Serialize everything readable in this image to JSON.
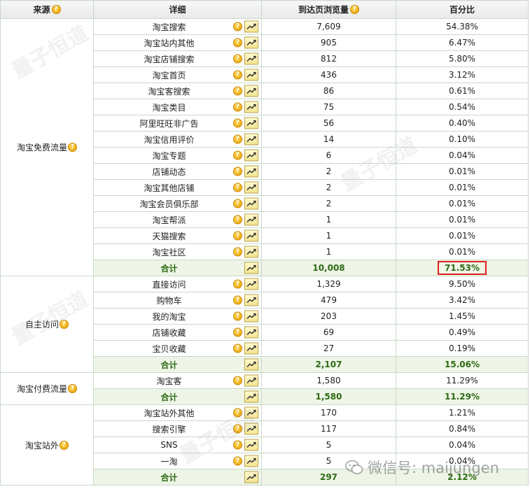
{
  "headers": {
    "source": "来源",
    "detail": "详细",
    "views": "到达页浏览量",
    "percent": "百分比"
  },
  "groups": [
    {
      "source": "淘宝免费流量",
      "rows": [
        {
          "detail": "淘宝搜索",
          "views": "7,609",
          "percent": "54.38%"
        },
        {
          "detail": "淘宝站内其他",
          "views": "905",
          "percent": "6.47%"
        },
        {
          "detail": "淘宝店铺搜索",
          "views": "812",
          "percent": "5.80%"
        },
        {
          "detail": "淘宝首页",
          "views": "436",
          "percent": "3.12%"
        },
        {
          "detail": "淘宝客搜索",
          "views": "86",
          "percent": "0.61%"
        },
        {
          "detail": "淘宝类目",
          "views": "75",
          "percent": "0.54%"
        },
        {
          "detail": "阿里旺旺非广告",
          "views": "56",
          "percent": "0.40%"
        },
        {
          "detail": "淘宝信用评价",
          "views": "14",
          "percent": "0.10%"
        },
        {
          "detail": "淘宝专题",
          "views": "6",
          "percent": "0.04%"
        },
        {
          "detail": "店铺动态",
          "views": "2",
          "percent": "0.01%"
        },
        {
          "detail": "淘宝其他店铺",
          "views": "2",
          "percent": "0.01%"
        },
        {
          "detail": "淘宝会员俱乐部",
          "views": "2",
          "percent": "0.01%"
        },
        {
          "detail": "淘宝帮派",
          "views": "1",
          "percent": "0.01%"
        },
        {
          "detail": "天猫搜索",
          "views": "1",
          "percent": "0.01%"
        },
        {
          "detail": "淘宝社区",
          "views": "1",
          "percent": "0.01%"
        }
      ],
      "total": {
        "label": "合计",
        "views": "10,008",
        "percent": "71.53%",
        "highlighted": true
      }
    },
    {
      "source": "自主访问",
      "rows": [
        {
          "detail": "直接访问",
          "views": "1,329",
          "percent": "9.50%"
        },
        {
          "detail": "购物车",
          "views": "479",
          "percent": "3.42%"
        },
        {
          "detail": "我的淘宝",
          "views": "203",
          "percent": "1.45%"
        },
        {
          "detail": "店铺收藏",
          "views": "69",
          "percent": "0.49%"
        },
        {
          "detail": "宝贝收藏",
          "views": "27",
          "percent": "0.19%"
        }
      ],
      "total": {
        "label": "合计",
        "views": "2,107",
        "percent": "15.06%",
        "highlighted": false
      }
    },
    {
      "source": "淘宝付费流量",
      "rows": [
        {
          "detail": "淘宝客",
          "views": "1,580",
          "percent": "11.29%"
        }
      ],
      "total": {
        "label": "合计",
        "views": "1,580",
        "percent": "11.29%",
        "highlighted": false
      }
    },
    {
      "source": "淘宝站外",
      "rows": [
        {
          "detail": "淘宝站外其他",
          "views": "170",
          "percent": "1.21%"
        },
        {
          "detail": "搜索引擎",
          "views": "117",
          "percent": "0.84%"
        },
        {
          "detail": "SNS",
          "views": "5",
          "percent": "0.04%"
        },
        {
          "detail": "一淘",
          "views": "5",
          "percent": "0.04%"
        }
      ],
      "total": {
        "label": "合计",
        "views": "297",
        "percent": "2.12%",
        "highlighted": false
      }
    }
  ],
  "icons": {
    "help": "?",
    "help_name": "help-icon",
    "trend_name": "trend-chart-icon"
  },
  "watermark": {
    "text": "量子恒道",
    "wechat": "微信号: maijungen"
  },
  "colors": {
    "total_text": "#2d6a14",
    "total_bg": "#eef5e6",
    "highlight_border": "#e0201a",
    "help_icon": "#f0a800",
    "border": "#c9d9c9"
  }
}
